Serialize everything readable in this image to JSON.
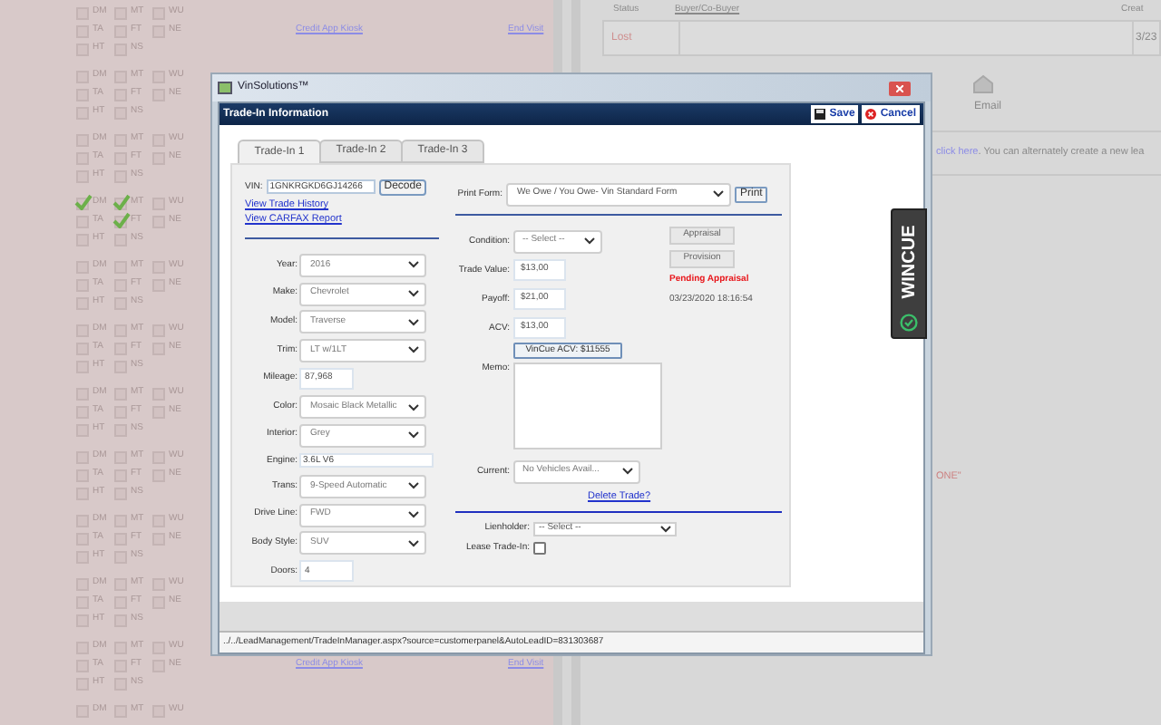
{
  "background": {
    "groups": [
      {
        "rows": [
          [
            {
              "label": "DM",
              "checked": false
            },
            {
              "label": "MT",
              "checked": false
            },
            {
              "label": "WU",
              "checked": false
            }
          ],
          [
            {
              "label": "TA",
              "checked": false
            },
            {
              "label": "FT",
              "checked": false
            },
            {
              "label": "NE",
              "checked": false
            }
          ],
          [
            {
              "label": "HT",
              "checked": false
            },
            {
              "label": "NS",
              "checked": false
            }
          ]
        ],
        "links": [
          "Credit App Kiosk",
          "End Visit"
        ]
      },
      {
        "rows": [
          [
            {
              "label": "DM",
              "checked": false
            },
            {
              "label": "MT",
              "checked": false
            },
            {
              "label": "WU",
              "checked": false
            }
          ],
          [
            {
              "label": "TA",
              "checked": false
            },
            {
              "label": "FT",
              "checked": false
            },
            {
              "label": "NE",
              "checked": false
            }
          ],
          [
            {
              "label": "HT",
              "checked": false
            },
            {
              "label": "NS",
              "checked": false
            }
          ]
        ]
      },
      {
        "rows": [
          [
            {
              "label": "DM",
              "checked": false
            },
            {
              "label": "MT",
              "checked": false
            },
            {
              "label": "WU",
              "checked": false
            }
          ],
          [
            {
              "label": "TA",
              "checked": false
            },
            {
              "label": "FT",
              "checked": false
            },
            {
              "label": "NE",
              "checked": false
            }
          ],
          [
            {
              "label": "HT",
              "checked": false
            },
            {
              "label": "NS",
              "checked": false
            }
          ]
        ]
      },
      {
        "rows": [
          [
            {
              "label": "DM",
              "checked": true
            },
            {
              "label": "MT",
              "checked": true
            },
            {
              "label": "WU",
              "checked": false
            }
          ],
          [
            {
              "label": "TA",
              "checked": false
            },
            {
              "label": "FT",
              "checked": true
            },
            {
              "label": "NE",
              "checked": false
            }
          ],
          [
            {
              "label": "HT",
              "checked": false
            },
            {
              "label": "NS",
              "checked": false
            }
          ]
        ]
      },
      {
        "rows": [
          [
            {
              "label": "DM",
              "checked": false
            },
            {
              "label": "MT",
              "checked": false
            },
            {
              "label": "WU",
              "checked": false
            }
          ],
          [
            {
              "label": "TA",
              "checked": false
            },
            {
              "label": "FT",
              "checked": false
            },
            {
              "label": "NE",
              "checked": false
            }
          ],
          [
            {
              "label": "HT",
              "checked": false
            },
            {
              "label": "NS",
              "checked": false
            }
          ]
        ]
      },
      {
        "rows": [
          [
            {
              "label": "DM",
              "checked": false
            },
            {
              "label": "MT",
              "checked": false
            },
            {
              "label": "WU",
              "checked": false
            }
          ],
          [
            {
              "label": "TA",
              "checked": false
            },
            {
              "label": "FT",
              "checked": false
            },
            {
              "label": "NE",
              "checked": false
            }
          ],
          [
            {
              "label": "HT",
              "checked": false
            },
            {
              "label": "NS",
              "checked": false
            }
          ]
        ]
      },
      {
        "rows": [
          [
            {
              "label": "DM",
              "checked": false
            },
            {
              "label": "MT",
              "checked": false
            },
            {
              "label": "WU",
              "checked": false
            }
          ],
          [
            {
              "label": "TA",
              "checked": false
            },
            {
              "label": "FT",
              "checked": false
            },
            {
              "label": "NE",
              "checked": false
            }
          ],
          [
            {
              "label": "HT",
              "checked": false
            },
            {
              "label": "NS",
              "checked": false
            }
          ]
        ]
      },
      {
        "rows": [
          [
            {
              "label": "DM",
              "checked": false
            },
            {
              "label": "MT",
              "checked": false
            },
            {
              "label": "WU",
              "checked": false
            }
          ],
          [
            {
              "label": "TA",
              "checked": false
            },
            {
              "label": "FT",
              "checked": false
            },
            {
              "label": "NE",
              "checked": false
            }
          ],
          [
            {
              "label": "HT",
              "checked": false
            },
            {
              "label": "NS",
              "checked": false
            }
          ]
        ]
      },
      {
        "rows": [
          [
            {
              "label": "DM",
              "checked": false
            },
            {
              "label": "MT",
              "checked": false
            },
            {
              "label": "WU",
              "checked": false
            }
          ],
          [
            {
              "label": "TA",
              "checked": false
            },
            {
              "label": "FT",
              "checked": false
            },
            {
              "label": "NE",
              "checked": false
            }
          ],
          [
            {
              "label": "HT",
              "checked": false
            },
            {
              "label": "NS",
              "checked": false
            }
          ]
        ]
      },
      {
        "rows": [
          [
            {
              "label": "DM",
              "checked": false
            },
            {
              "label": "MT",
              "checked": false
            },
            {
              "label": "WU",
              "checked": false
            }
          ],
          [
            {
              "label": "TA",
              "checked": false
            },
            {
              "label": "FT",
              "checked": false
            },
            {
              "label": "NE",
              "checked": false
            }
          ],
          [
            {
              "label": "HT",
              "checked": false
            },
            {
              "label": "NS",
              "checked": false
            }
          ]
        ]
      },
      {
        "rows": [
          [
            {
              "label": "DM",
              "checked": false
            },
            {
              "label": "MT",
              "checked": false
            },
            {
              "label": "WU",
              "checked": false
            }
          ],
          [
            {
              "label": "TA",
              "checked": false
            },
            {
              "label": "FT",
              "checked": false
            },
            {
              "label": "NE",
              "checked": false
            }
          ],
          [
            {
              "label": "HT",
              "checked": false
            },
            {
              "label": "NS",
              "checked": false
            }
          ]
        ],
        "links": [
          "Credit App Kiosk",
          "End Visit"
        ]
      },
      {
        "rows": [
          [
            {
              "label": "DM",
              "checked": false
            },
            {
              "label": "MT",
              "checked": false
            },
            {
              "label": "WU",
              "checked": false
            }
          ]
        ]
      }
    ],
    "table": {
      "columns": [
        "Status",
        "Buyer/Co-Buyer",
        "Creat"
      ],
      "status": "Lost",
      "created": "3/23"
    },
    "action": {
      "label": "Email"
    },
    "notice": {
      "link": "click here",
      "text": ". You can alternately create a new lea"
    },
    "fragment": "ONE\""
  },
  "window": {
    "title": "VinSolutions™",
    "header": "Trade-In Information",
    "buttons": [
      {
        "label": "Save",
        "kind": "save"
      },
      {
        "label": "Cancel",
        "kind": "cancel"
      }
    ],
    "tabs": [
      {
        "label": "Trade-In 1",
        "selected": true
      },
      {
        "label": "Trade-In 2",
        "selected": false
      },
      {
        "label": "Trade-In 3",
        "selected": false
      }
    ],
    "vin": {
      "label": "VIN:",
      "value": "1GNKRGKD6GJ14266",
      "button": "Decode"
    },
    "links": [
      "View Trade History",
      "View CARFAX Report"
    ],
    "vehicle_fields": [
      {
        "label": "Year:",
        "value": "2016",
        "kind": "select"
      },
      {
        "label": "Make:",
        "value": "Chevrolet",
        "kind": "select"
      },
      {
        "label": "Model:",
        "value": "Traverse",
        "kind": "select"
      },
      {
        "label": "Trim:",
        "value": "LT w/1LT",
        "kind": "select"
      },
      {
        "label": "Mileage:",
        "value": "87,968",
        "kind": "input"
      },
      {
        "label": "Color:",
        "value": "Mosaic Black Metallic",
        "kind": "select"
      },
      {
        "label": "Interior:",
        "value": "Grey",
        "kind": "select"
      },
      {
        "label": "Engine:",
        "value": "3.6L V6",
        "kind": "wide"
      },
      {
        "label": "Trans:",
        "value": "9-Speed Automatic",
        "kind": "select"
      },
      {
        "label": "Drive Line:",
        "value": "FWD",
        "kind": "select"
      },
      {
        "label": "Body Style:",
        "value": "SUV",
        "kind": "select"
      },
      {
        "label": "Doors:",
        "value": "4",
        "kind": "input"
      }
    ],
    "print": {
      "label": "Print Form:",
      "value": "We Owe / You Owe- Vin Standard Form",
      "button": "Print"
    },
    "deal_fields": [
      {
        "label": "Condition:",
        "value": "-- Select --",
        "kind": "select"
      },
      {
        "label": "Trade Value:",
        "value": "$13,00",
        "kind": "input"
      },
      {
        "label": "Payoff:",
        "value": "$21,00",
        "kind": "input"
      },
      {
        "label": "ACV:",
        "value": "$13,00",
        "kind": "input",
        "button": "VinCue ACV: $11555"
      },
      {
        "label": "Memo:",
        "kind": "textarea"
      },
      {
        "label": "Current:",
        "value": "No Vehicles Avail...",
        "kind": "select"
      }
    ],
    "delete_link": "Delete Trade?",
    "lienholder": {
      "label": "Lienholder:",
      "value": "-- Select --"
    },
    "lease": {
      "label": "Lease Trade-In:",
      "checked": false
    },
    "side_buttons": [
      "Appraisal",
      "Provision"
    ],
    "appraisal_status": {
      "text": "Pending Appraisal",
      "date": "03/23/2020 18:16:54"
    },
    "status_bar": "../../LeadManagement/TradeInManager.aspx?source=customerpanel&AutoLeadID=831303687"
  },
  "side_tab": {
    "label": "WINCUE"
  }
}
